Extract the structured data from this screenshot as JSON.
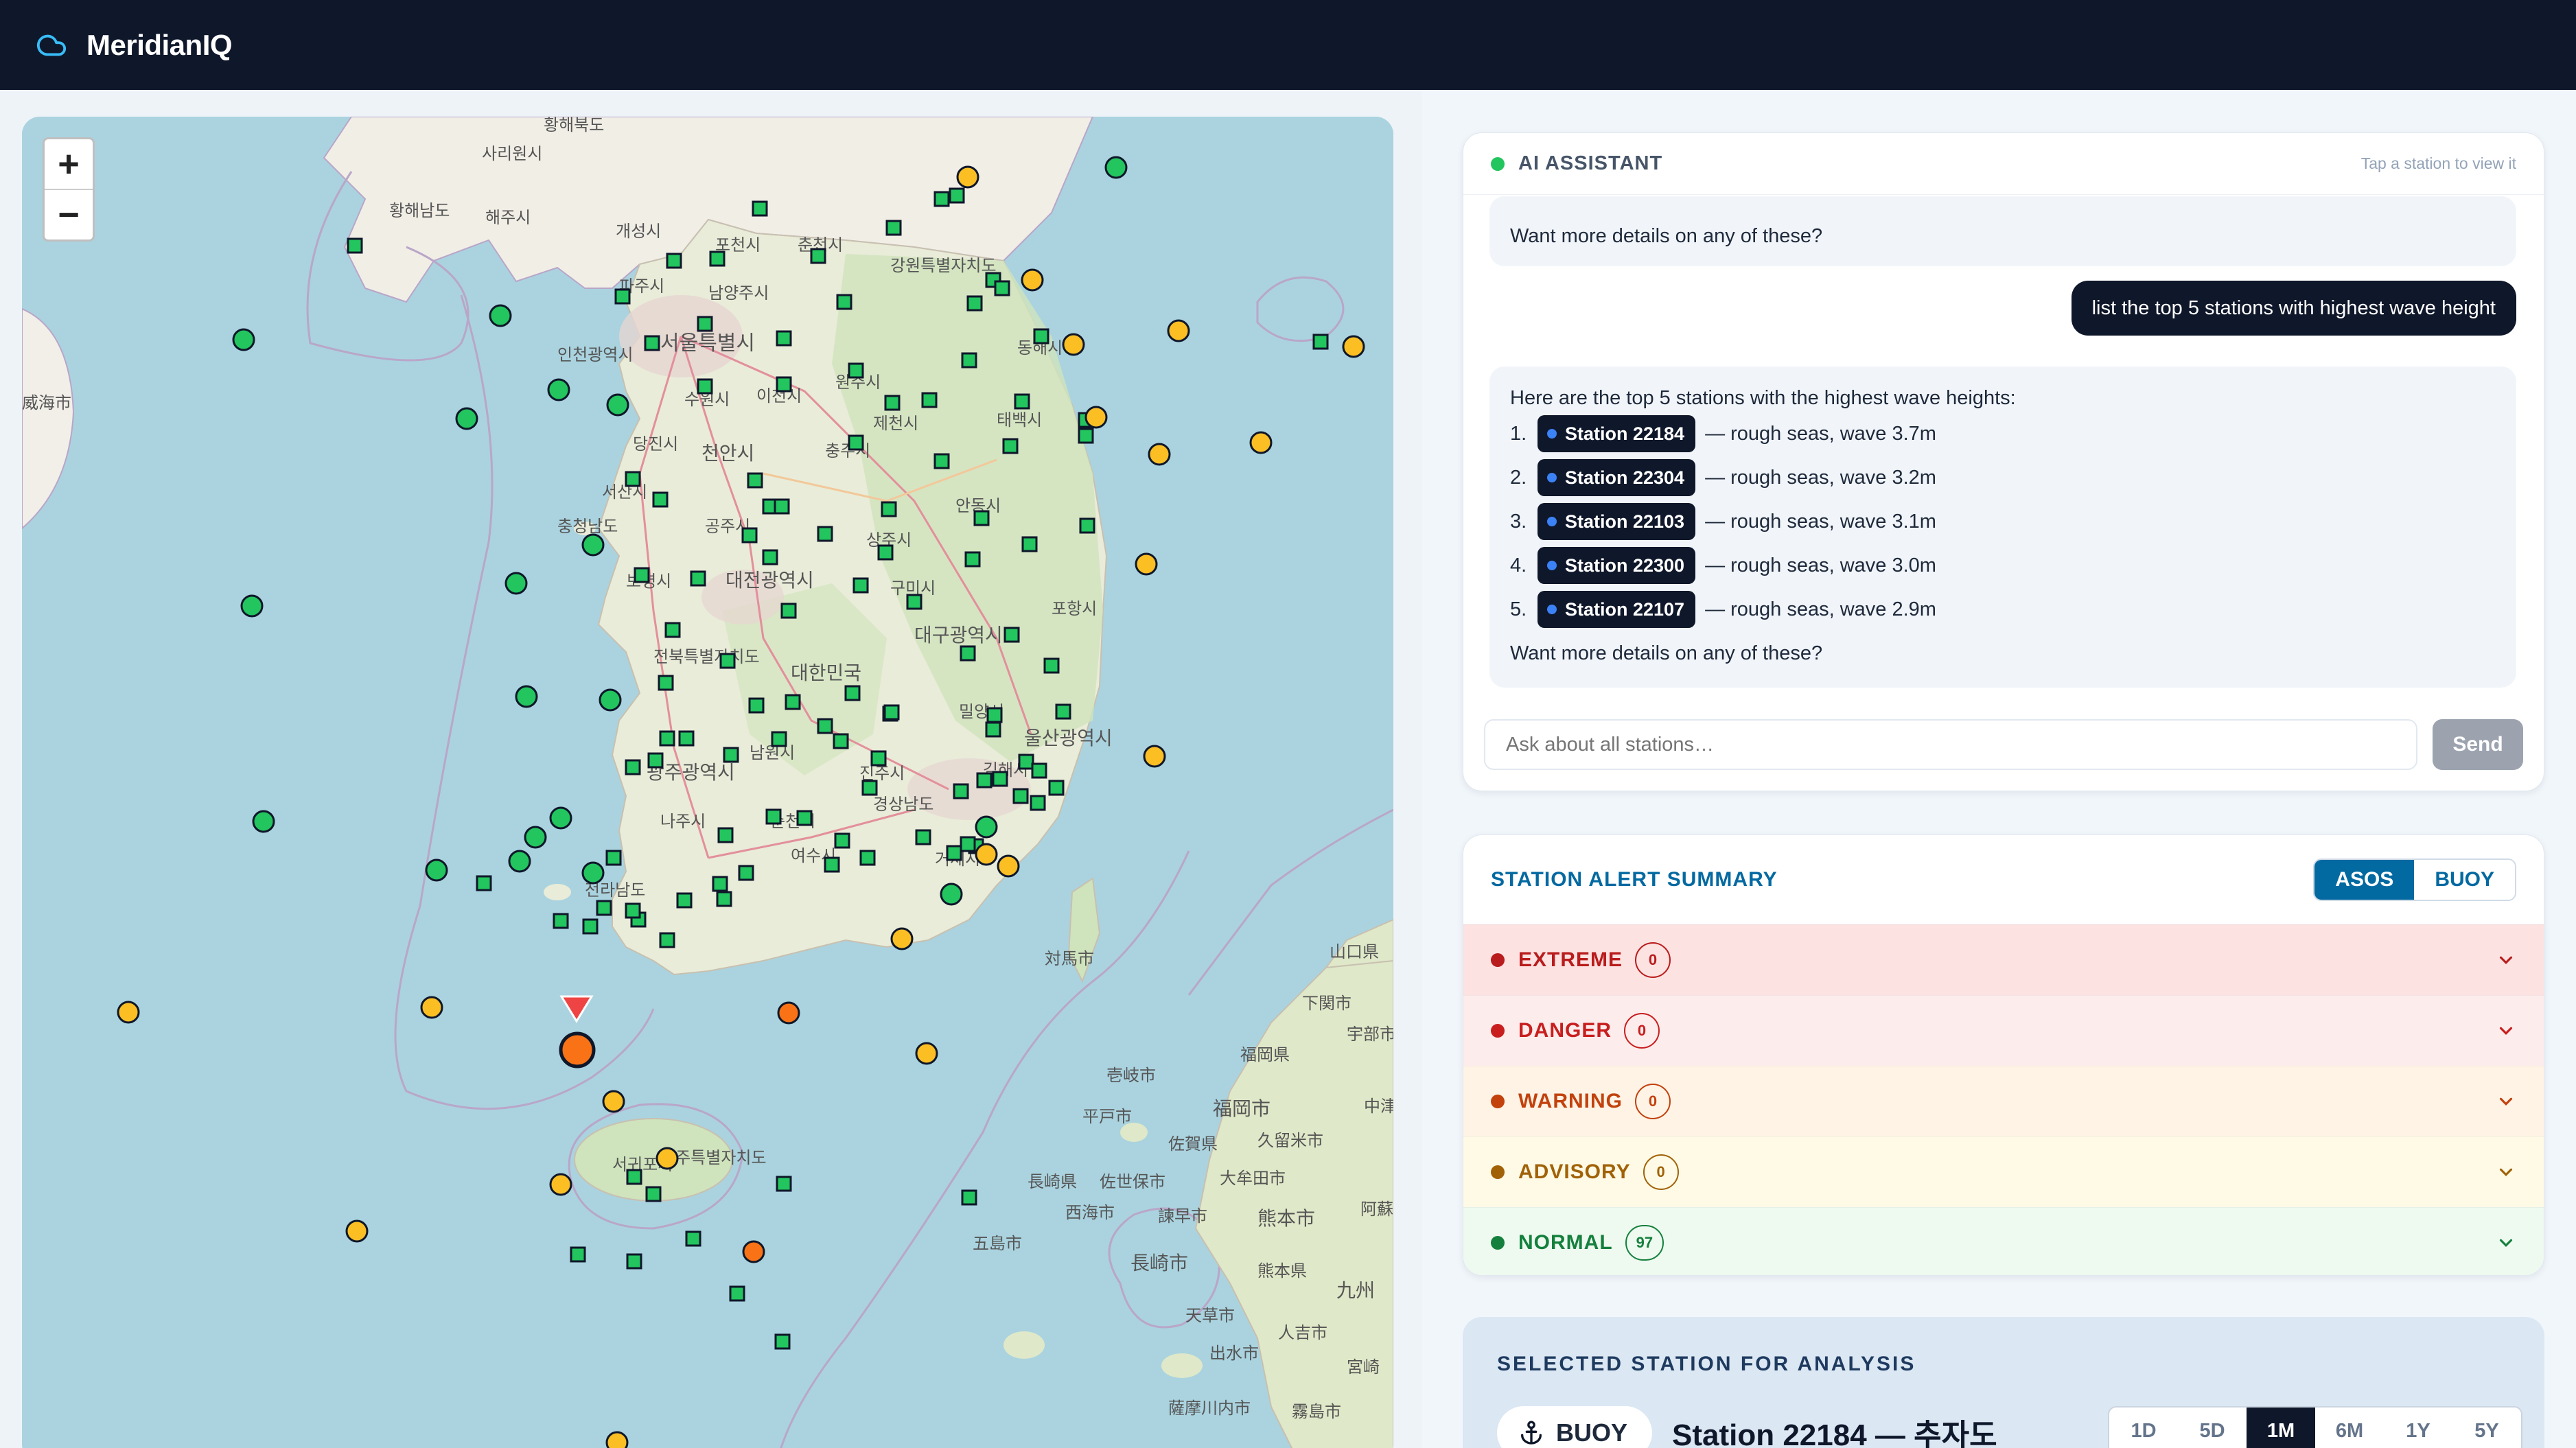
{
  "app": {
    "title": "MeridianIQ"
  },
  "map": {
    "zoom_in": "+",
    "zoom_out": "−",
    "labels": {
      "northwest": "황해북도",
      "sariwon": "사리원시",
      "hwanghae_south": "황해남도",
      "haeju": "해주시",
      "kaesong": "개성시",
      "pocheon": "포천시",
      "chuncheon": "춘천시",
      "gangwon": "강원특별자치도",
      "namyangju": "남양주시",
      "paju": "파주시",
      "seoul": "서울특별시",
      "incheon": "인천광역시",
      "suwon": "수원시",
      "icheon": "이천시",
      "wonju": "원주시",
      "donghae": "동해시",
      "taebaek": "태백시",
      "jecheon": "제천시",
      "chungju": "충주시",
      "dangjin": "당진시",
      "cheonan": "천안시",
      "seosan": "서산시",
      "chungnam": "충청남도",
      "gongju": "공주시",
      "andong": "안동시",
      "sangju": "상주시",
      "boryeong": "보령시",
      "daejeon": "대전광역시",
      "gumi": "구미시",
      "pohang": "포항시",
      "daegu": "대구광역시",
      "jeonbuk": "전북특별자치도",
      "korea": "대한민국",
      "miryang": "밀양시",
      "ulsan": "울산광역시",
      "namwon": "남원시",
      "gwangju": "광주광역시",
      "jinju": "진주시",
      "gimhae": "김해시",
      "gyeongnam": "경상남도",
      "naju": "나주시",
      "suncheon": "순천시",
      "yeosu": "여수시",
      "geoje": "거제시",
      "jeonnam": "전라남도",
      "tsushima": "対馬市",
      "yamaguchi": "山口県",
      "shimonoseki": "下関市",
      "ube": "宇部市",
      "fukuoka_pref": "福岡県",
      "fukuoka": "福岡市",
      "jeju_prov": "제주특별자치도",
      "seogwipo": "서귀포시",
      "iki": "壱岐市",
      "hirado": "平戸市",
      "saga_pref": "佐賀県",
      "kurume": "久留米市",
      "nagasaki_pref": "長崎県",
      "sasebo": "佐世保市",
      "omuta": "大牟田市",
      "saikai": "西海市",
      "isahaya": "諫早市",
      "kumamoto": "熊本市",
      "goto": "五島市",
      "nagasaki": "長崎市",
      "kumamoto_pref": "熊本県",
      "kyushu": "九州",
      "amakusa": "天草市",
      "hitoyoshi": "人吉市",
      "izumi": "出水市",
      "satsumasendai": "薩摩川内市",
      "kirishima": "霧島市",
      "miyazaki": "宮崎",
      "chukan": "中津市",
      "aso": "阿蘇",
      "china_city": "威海市"
    }
  },
  "assistant": {
    "title": "AI ASSISTANT",
    "hint": "Tap a station to view it",
    "prev_followup": "Want more details on any of these?",
    "user_message": "list the top 5 stations with highest wave height",
    "response_intro": "Here are the top 5 stations with the highest wave heights:",
    "results": [
      {
        "rank": "1.",
        "station": "Station 22184",
        "desc": "— rough seas, wave 3.7m"
      },
      {
        "rank": "2.",
        "station": "Station 22304",
        "desc": "— rough seas, wave 3.2m"
      },
      {
        "rank": "3.",
        "station": "Station 22103",
        "desc": "— rough seas, wave 3.1m"
      },
      {
        "rank": "4.",
        "station": "Station 22300",
        "desc": "— rough seas, wave 3.0m"
      },
      {
        "rank": "5.",
        "station": "Station 22107",
        "desc": "— rough seas, wave 2.9m"
      }
    ],
    "followup": "Want more details on any of these?",
    "input_placeholder": "Ask about all stations…",
    "send_label": "Send"
  },
  "alerts": {
    "title": "STATION ALERT SUMMARY",
    "tab_asos": "ASOS",
    "tab_buoy": "BUOY",
    "rows": [
      {
        "label": "EXTREME",
        "count": "0",
        "color": "#b91c1c",
        "bg": "#fde2e2"
      },
      {
        "label": "DANGER",
        "count": "0",
        "color": "#c81e1e",
        "bg": "#fdecec"
      },
      {
        "label": "WARNING",
        "count": "0",
        "color": "#c2410c",
        "bg": "#fff3e6"
      },
      {
        "label": "ADVISORY",
        "count": "0",
        "color": "#a16207",
        "bg": "#fefae6"
      },
      {
        "label": "NORMAL",
        "count": "97",
        "color": "#15803d",
        "bg": "#eef9f0"
      }
    ]
  },
  "analysis": {
    "title": "SELECTED STATION FOR ANALYSIS",
    "type": "BUOY",
    "station": "Station 22184 — 추자도",
    "ranges": [
      "1D",
      "5D",
      "1M",
      "6M",
      "1Y",
      "5Y"
    ],
    "selected_range": "1M"
  },
  "colors": {
    "accent": "#0369a1",
    "normal": "#22c55e",
    "advisory": "#fbbf24",
    "warning": "#f97316",
    "danger": "#ef4444"
  }
}
